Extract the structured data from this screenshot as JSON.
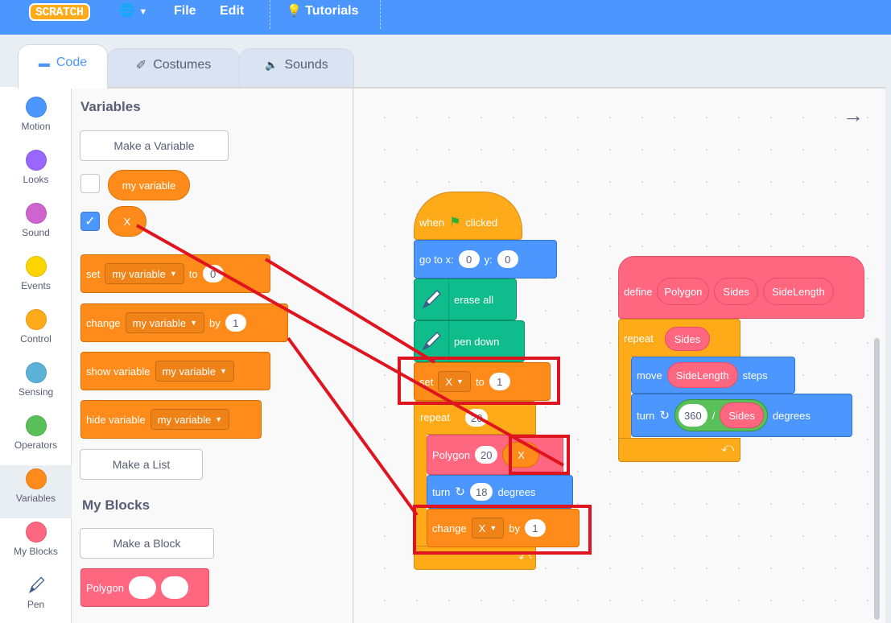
{
  "menubar": {
    "logo": "SCRATCH",
    "file": "File",
    "edit": "Edit",
    "tutorials": "Tutorials"
  },
  "tabs": {
    "code": "Code",
    "costumes": "Costumes",
    "sounds": "Sounds"
  },
  "categories": [
    {
      "label": "Motion",
      "color": "#4c97ff"
    },
    {
      "label": "Looks",
      "color": "#9966ff"
    },
    {
      "label": "Sound",
      "color": "#cf63cf"
    },
    {
      "label": "Events",
      "color": "#ffd500"
    },
    {
      "label": "Control",
      "color": "#ffab19"
    },
    {
      "label": "Sensing",
      "color": "#5cb1d6"
    },
    {
      "label": "Operators",
      "color": "#59c059"
    },
    {
      "label": "Variables",
      "color": "#ff8c1a"
    },
    {
      "label": "My Blocks",
      "color": "#ff6680"
    },
    {
      "label": "Pen",
      "color": "#0fbd8c"
    }
  ],
  "palette": {
    "variables_heading": "Variables",
    "make_variable": "Make a Variable",
    "var_my_variable": "my variable",
    "var_x": "X",
    "set_block": {
      "label": "set",
      "var": "my variable",
      "to": "to",
      "value": "0"
    },
    "change_block": {
      "label": "change",
      "var": "my variable",
      "by": "by",
      "value": "1"
    },
    "show_block": {
      "label": "show variable",
      "var": "my variable"
    },
    "hide_block": {
      "label": "hide variable",
      "var": "my variable"
    },
    "make_list": "Make a List",
    "my_blocks_heading": "My Blocks",
    "make_block": "Make a Block",
    "polygon_block": "Polygon"
  },
  "script": {
    "hat": {
      "when": "when",
      "clicked": "clicked"
    },
    "goto": {
      "label": "go to x:",
      "x": "0",
      "y_label": "y:",
      "y": "0"
    },
    "erase": "erase all",
    "pendown": "pen down",
    "set": {
      "label": "set",
      "var": "X",
      "to": "to",
      "value": "1"
    },
    "repeat": {
      "label": "repeat",
      "value": "20"
    },
    "polygon": {
      "label": "Polygon",
      "value": "20",
      "reporter": "X"
    },
    "turn": {
      "label": "turn",
      "value": "18",
      "suffix": "degrees"
    },
    "change": {
      "label": "change",
      "var": "X",
      "by": "by",
      "value": "1"
    }
  },
  "define_script": {
    "define": "define",
    "name": "Polygon",
    "param1": "Sides",
    "param2": "SideLength",
    "repeat": "repeat",
    "repeat_arg": "Sides",
    "move": "move",
    "move_arg": "SideLength",
    "steps": "steps",
    "turn": "turn",
    "numerator": "360",
    "divide": "/",
    "denominator": "Sides",
    "degrees": "degrees"
  },
  "colors": {
    "accent": "#4c97ff",
    "variables": "#ff8c1a",
    "control": "#ffab19",
    "myblocks": "#ff6680",
    "pen": "#0fbd8c",
    "annotation": "#e0141e"
  }
}
